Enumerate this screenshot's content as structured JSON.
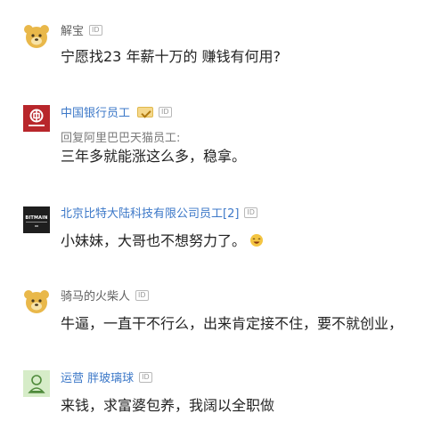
{
  "comments": [
    {
      "name": "解宝",
      "id_badge": "ID",
      "text": "宁愿找23 年薪十万的 赚钱有何用?",
      "avatar_icon": "cartoon-bear-avatar-icon"
    },
    {
      "name": "中国银行员工",
      "id_badge": "ID",
      "verified": true,
      "reply_to": "回复阿里巴巴天猫员工:",
      "text": "三年多就能涨这么多，稳拿。",
      "avatar_icon": "bank-of-china-logo-icon"
    },
    {
      "name": "北京比特大陆科技有限公司员工[2]",
      "id_badge": "ID",
      "text": "小妹妹，大哥也不想努力了。",
      "avatar_icon": "bitmain-logo-icon",
      "avatar_text": "BITMAIN"
    },
    {
      "name": "骑马的火柴人",
      "id_badge": "ID",
      "text": "牛逼，一直干不行么，出来肯定接不住，要不就创业，",
      "avatar_icon": "cartoon-bear-avatar-icon"
    },
    {
      "name": "运营 胖玻璃球",
      "id_badge": "ID",
      "text": "来钱，求富婆包养，我阔以全职做",
      "avatar_icon": "person-silhouette-avatar-icon"
    }
  ],
  "colors": {
    "company_name": "#3c78c8",
    "user_name": "#5f5f5f",
    "bear_face": "#e9b84a",
    "boc_red": "#b8262b"
  }
}
